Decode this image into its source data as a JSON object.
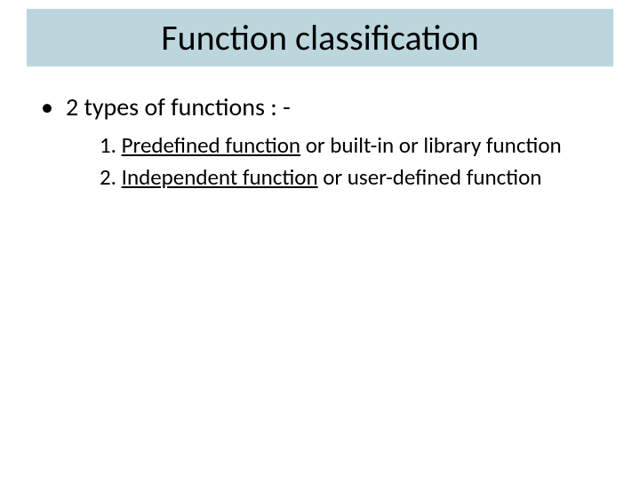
{
  "title": "Function classification",
  "bullet": "2 types of functions : -",
  "sub": [
    {
      "num": "1. ",
      "u": "Predefined function",
      "rest": " or built-in or library function"
    },
    {
      "num": "2. ",
      "u": "Independent function",
      "rest": " or user-defined function"
    }
  ]
}
